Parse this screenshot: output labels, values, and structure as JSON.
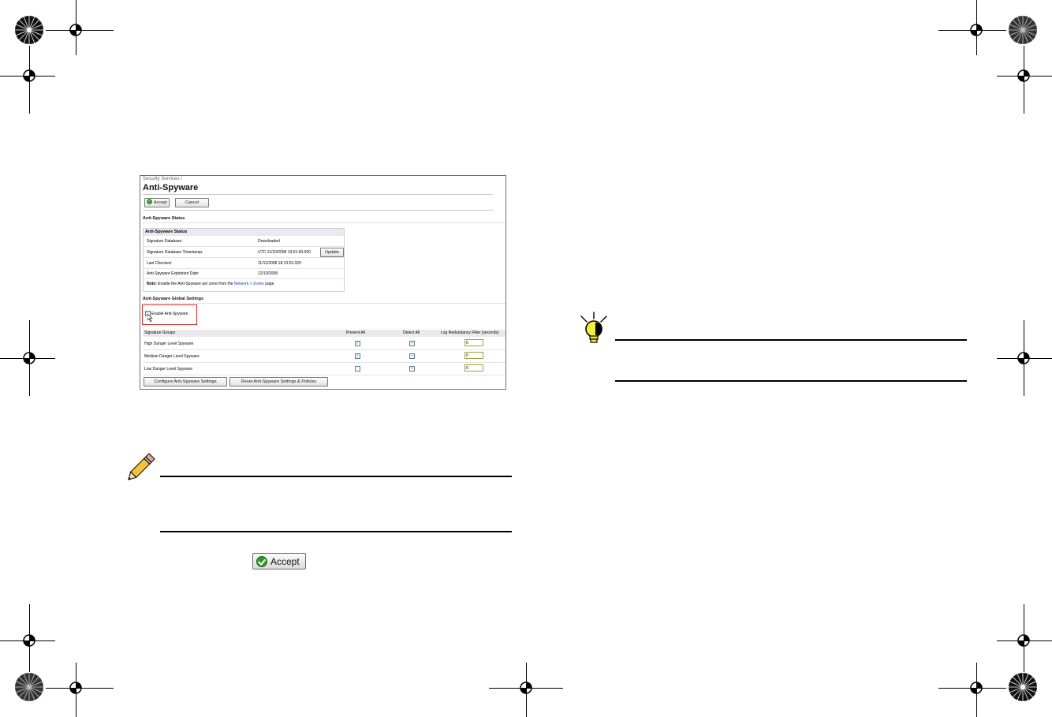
{
  "screenshot": {
    "breadcrumb": "Security Services /",
    "title": "Anti-Spyware",
    "toolbar": {
      "accept_label": "Accept",
      "cancel_label": "Cancel"
    },
    "status_section_header": "Anti-Spyware Status",
    "status_box": {
      "header": "Anti-Spyware Status",
      "rows": [
        {
          "key": "Signature Database:",
          "value": "Downloaded"
        },
        {
          "key": "Signature Database Timestamp:",
          "value": "UTC 11/10/2008 13:01:59.000",
          "button": "Update"
        },
        {
          "key": "Last Checked:",
          "value": "11/11/2008 18:13:53.320"
        },
        {
          "key": "Anti-Spyware Expiration Date:",
          "value": "12/10/2008"
        }
      ],
      "note_label": "Note:",
      "note_text": "Enable the Anti-Spyware per zone from the",
      "note_link": "Network > Zones",
      "note_suffix": "page."
    },
    "global_section_header": "Anti-Spyware Global Settings",
    "enable_label": "Enable Anti-Spyware",
    "enable_checked": true,
    "sig_table": {
      "columns": [
        "Signature Groups",
        "Prevent All",
        "Detect All",
        "Log Redundancy Filter (seconds)"
      ],
      "rows": [
        {
          "group": "High Danger Level Spyware",
          "prevent": true,
          "detect": true,
          "filter": "0"
        },
        {
          "group": "Medium Danger Level Spyware",
          "prevent": true,
          "detect": true,
          "filter": "0"
        },
        {
          "group": "Low Danger Level Spyware",
          "prevent": false,
          "detect": true,
          "filter": "0"
        }
      ]
    },
    "buttons": {
      "configure": "Configure Anti-Spyware Settings",
      "reset": "Reset Anti-Spyware Settings & Policies"
    }
  },
  "accept_button_label": "Accept",
  "icons": [
    "pencil-icon",
    "lightbulb-icon",
    "registration-mark-icon",
    "starburst-icon",
    "checkmark-icon"
  ]
}
